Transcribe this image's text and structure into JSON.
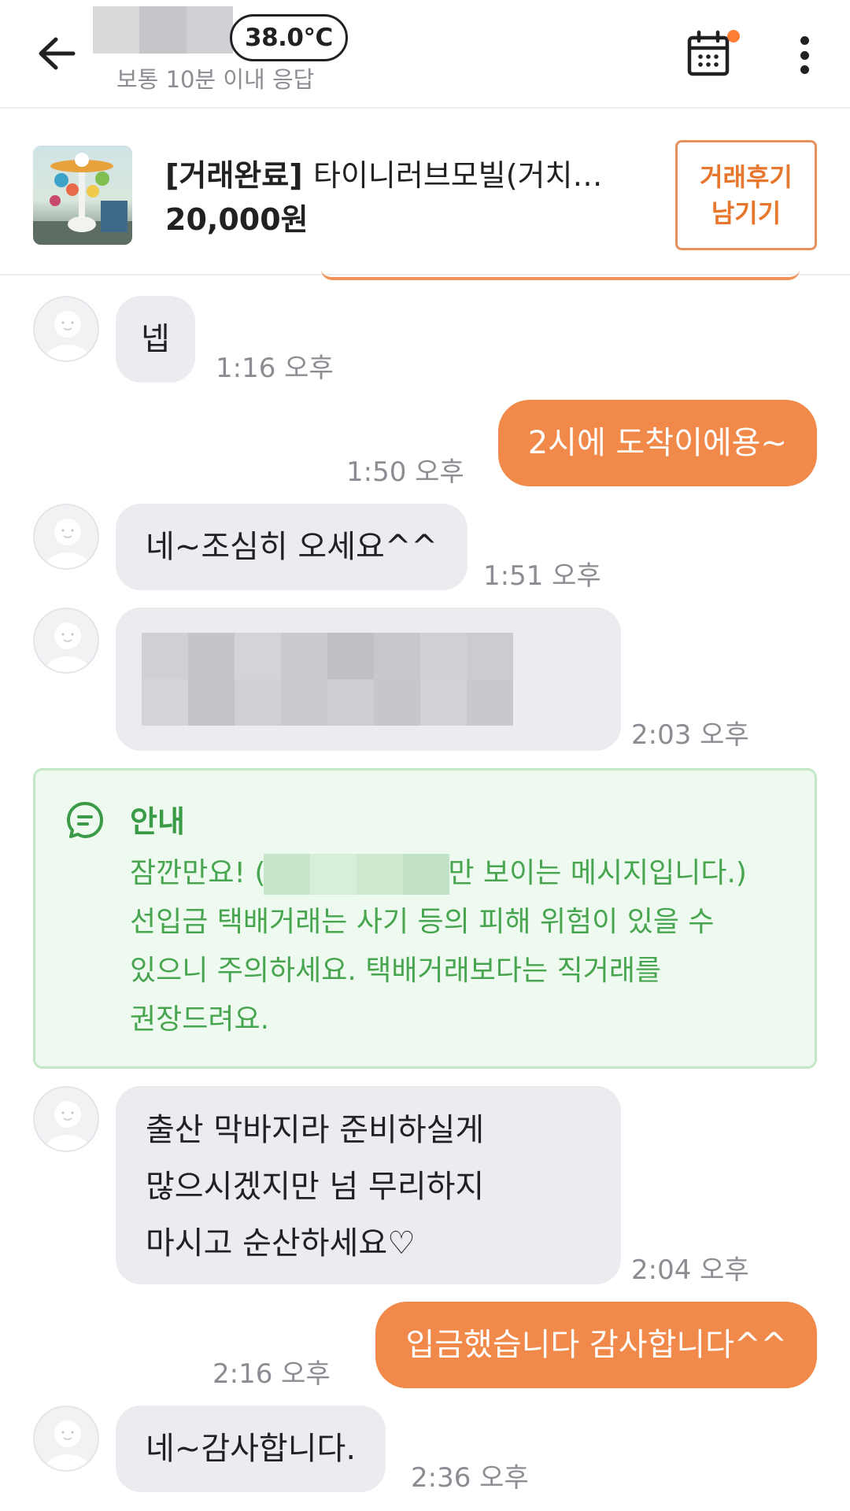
{
  "header": {
    "temperature": "38.0°C",
    "response_time": "보통 10분 이내 응답"
  },
  "product": {
    "status": "[거래완료]",
    "name": "타이니러브모빌(거치…",
    "price": "20,000원",
    "review_button_line1": "거래후기",
    "review_button_line2": "남기기"
  },
  "messages": {
    "m1": {
      "text": "넵",
      "time": "1:16 오후"
    },
    "m2": {
      "text": "2시에 도착이에용~",
      "time": "1:50 오후"
    },
    "m3": {
      "text": "네~조심히 오세요^^",
      "time": "1:51 오후"
    },
    "m4": {
      "time": "2:03 오후"
    },
    "m5": {
      "line1": "출산 막바지라 준비하실게",
      "line2": "많으시겠지만 넘 무리하지",
      "line3": "마시고 순산하세요♡",
      "time": "2:04 오후"
    },
    "m6": {
      "text": "입금했습니다 감사합니다^^",
      "time": "2:16 오후"
    },
    "m7": {
      "text": "네~감사합니다.",
      "time": "2:36 오후"
    }
  },
  "notice": {
    "title": "안내",
    "line1_before": "잠깐만요! (",
    "line1_after": "만 보이는 메시지입니다.)",
    "line2": "선입금 택배거래는 사기 등의 피해 위험이 있을 수",
    "line3": "있으니 주의하세요. 택배거래보다는 직거래를",
    "line4": "권장드려요."
  },
  "colors": {
    "accent_orange": "#f0894a",
    "notice_green": "#48a54f",
    "bubble_gray": "#eaecef"
  },
  "icons": [
    "arrow-left-icon",
    "calendar-icon",
    "more-vertical-icon",
    "chat-notice-icon",
    "default-avatar-icon"
  ]
}
